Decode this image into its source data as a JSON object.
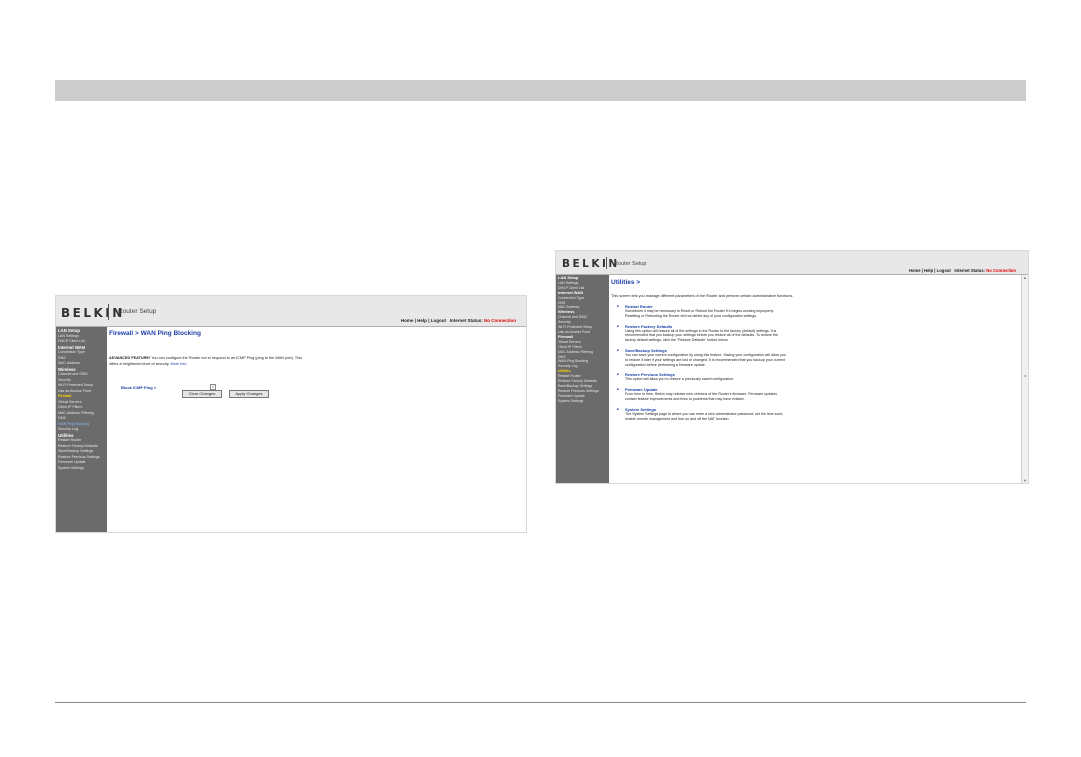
{
  "brand": "BELKIN",
  "router_setup": "Router Setup",
  "top_links": {
    "home": "Home",
    "help": "Help",
    "logout": "Logout",
    "status_label": "Internet Status:",
    "status_value": "No Connection"
  },
  "left_page": {
    "title": "Firewall > WAN Ping Blocking",
    "adv_label": "ADVANCED FEATURE!",
    "adv_line1": " You can configure the Router not to respond to an ICMP Ping (ping to the WAN port). This",
    "adv_line2": "offers a heightened level of security. ",
    "more_info": "More Info",
    "field_label": "Block ICMP Ping >",
    "check_mark": "✓",
    "clear_button": "Clear Changes",
    "apply_button": "Apply Changes"
  },
  "right_page": {
    "title": "Utilities >",
    "intro": "This screen lets you manage different parameters of the Router and perform certain administrative functions.",
    "items": [
      {
        "title": "Restart Router",
        "lines": [
          "Sometimes it may be necessary to Reset or Reboot the Router if it begins working improperly.",
          "Resetting or Rebooting the Router will not delete any of your configuration settings."
        ]
      },
      {
        "title": "Restore Factory Defaults",
        "lines": [
          "Using this option will restore all of the settings in the Router to the factory (default) settings. It is",
          "recommended that you backup your settings before you restore all of the defaults. To restore the",
          "factory default settings, click the \"Restore Defaults\" button below."
        ]
      },
      {
        "title": "Save/Backup Settings",
        "lines": [
          "You can save your current configuration by using this feature. Saving your configuration will allow you",
          "to restore it later if your settings are lost or changed. It is recommended that you backup your current",
          "configuration before performing a firmware update."
        ]
      },
      {
        "title": "Restore Previous Settings",
        "lines": [
          "This option will allow you to restore a previously saved configuration."
        ]
      },
      {
        "title": "Firmware Update",
        "lines": [
          "From time to time, Belkin may release new versions of the Router's firmware. Firmware updates",
          "contain feature improvements and fixes to problems that may have existed."
        ]
      },
      {
        "title": "System Settings",
        "lines": [
          "The System Settings page is where you can enter a new administrator password, set the time zone,",
          "enable remote management and turn on and off the NAT function."
        ]
      }
    ]
  },
  "sidebar": {
    "lan_setup": "LAN Setup",
    "lan_settings": "LAN Settings",
    "dhcp_client_list": "DHCP Client List",
    "internet_wan": "Internet WAN",
    "connection_type": "Connection Type",
    "dns": "DNS",
    "mac_address": "MAC Address",
    "wireless": "Wireless",
    "channel_ssid": "Channel and SSID",
    "security": "Security",
    "wps": "Wi-Fi Protected Setup",
    "access_point": "Use as Access Point",
    "firewall": "Firewall",
    "virtual_servers": "Virtual Servers",
    "client_ip_filters": "Client IP Filters",
    "mac_filtering": "MAC Address Filtering",
    "dmz": "DMZ",
    "wan_ping": "WAN Ping Blocking",
    "security_log": "Security Log",
    "utilities": "Utilities",
    "restart_router": "Restart Router",
    "restore_defaults": "Restore Factory Defaults",
    "save_backup": "Save/Backup Settings",
    "restore_previous": "Restore Previous Settings",
    "firmware_update": "Firmware Update",
    "system_settings": "System Settings"
  },
  "colors": {
    "accent_blue": "#1a3ea8",
    "status_red": "#e00000",
    "sidebar_bg": "#6b6b6b",
    "sidebar_highlight": "#ffd400"
  }
}
